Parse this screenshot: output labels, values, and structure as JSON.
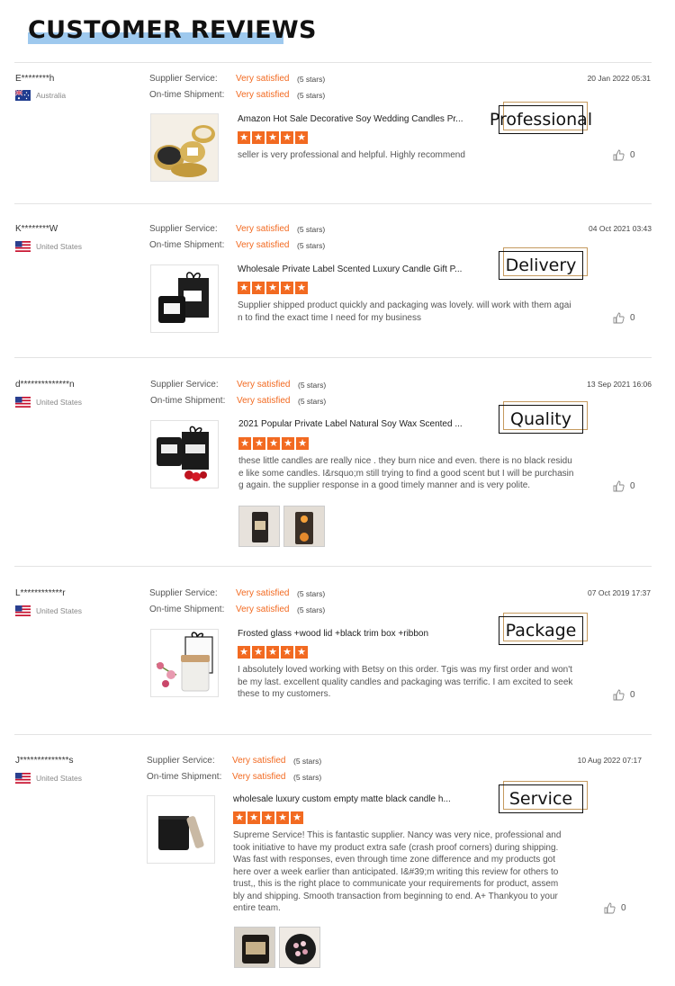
{
  "page": {
    "title": "CUSTOMER REVIEWS"
  },
  "labels": {
    "supplier_service": "Supplier Service:",
    "ontime_shipment": "On-time Shipment:"
  },
  "colors": {
    "accent": "#f26a21",
    "title_highlight": "#9ec9ee",
    "tag_frame_gold": "#c59a5f"
  },
  "reviews": [
    {
      "username": "E********h",
      "country": "Australia",
      "flag": "australia-flag-icon",
      "supplier_rating": "Very satisfied",
      "supplier_stars": "(5 stars)",
      "shipment_rating": "Very satisfied",
      "shipment_stars": "(5 stars)",
      "date": "20 Jan 2022 05:31",
      "product_title": "Amazon Hot Sale Decorative Soy Wedding Candles Pr...",
      "rating": 5,
      "comment": "seller is very professional and helpful. Highly recommend",
      "tag": "Professional",
      "likes": "0"
    },
    {
      "username": "K********W",
      "country": "United States",
      "flag": "us-flag-icon",
      "supplier_rating": "Very satisfied",
      "supplier_stars": "(5 stars)",
      "shipment_rating": "Very satisfied",
      "shipment_stars": "(5 stars)",
      "date": "04 Oct 2021 03:43",
      "product_title": "Wholesale Private Label Scented Luxury Candle Gift P...",
      "rating": 5,
      "comment": "Supplier shipped product quickly and packaging was lovely. will work with them again to find the exact time I need for my business",
      "tag": "Delivery",
      "likes": "0"
    },
    {
      "username": "d**************n",
      "country": "United States",
      "flag": "us-flag-icon",
      "supplier_rating": "Very satisfied",
      "supplier_stars": "(5 stars)",
      "shipment_rating": "Very satisfied",
      "shipment_stars": "(5 stars)",
      "date": "13 Sep 2021 16:06",
      "product_title": "2021 Popular Private Label Natural Soy Wax Scented ...",
      "rating": 5,
      "comment": "these little candles are really nice . they burn nice and even. there is no black residue like some candles. I&rsquo;m still trying to find a good scent but I will be purchasing again. the supplier response in a good timely manner and is very polite.",
      "tag": "Quality",
      "likes": "0"
    },
    {
      "username": "L************r",
      "country": "United States",
      "flag": "us-flag-icon",
      "supplier_rating": "Very satisfied",
      "supplier_stars": "(5 stars)",
      "shipment_rating": "Very satisfied",
      "shipment_stars": "(5 stars)",
      "date": "07 Oct 2019 17:37",
      "product_title": "Frosted glass +wood lid +black trim box +ribbon",
      "rating": 5,
      "comment": "I absolutely loved working with Betsy on this order. Tgis was my first order and won't be my last. excellent quality candles and packaging was terrific. I am excited to seek these to my customers.",
      "tag": "Package",
      "likes": "0"
    },
    {
      "username": "J**************s",
      "country": "United States",
      "flag": "us-flag-icon",
      "supplier_rating": "Very satisfied",
      "supplier_stars": "(5 stars)",
      "shipment_rating": "Very satisfied",
      "shipment_stars": "(5 stars)",
      "date": "10 Aug 2022 07:17",
      "product_title": "wholesale luxury custom empty matte black candle h...",
      "rating": 5,
      "comment": "Supreme Service! This is fantastic supplier. Nancy was very nice, professional and took initiative to have my product extra safe (crash proof corners) during shipping. Was fast with responses, even through time zone difference and my products got here over a week earlier than anticipated. I&#39;m writing this review for others to trust,, this is the right place to communicate your requirements for product, assembly and shipping. Smooth transaction from beginning to end. A+ Thankyou to your entire team.",
      "tag": "Service",
      "likes": "0"
    }
  ]
}
